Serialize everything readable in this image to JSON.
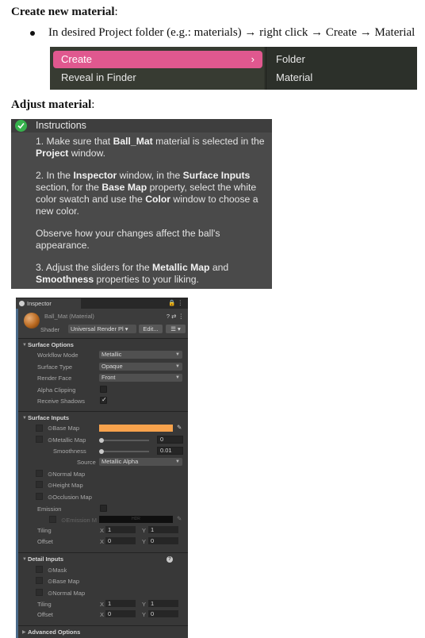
{
  "heading1": {
    "bold": "Create new material",
    "rest": ":"
  },
  "step_text": "In desired Project folder (e.g.: materials) → right click → Create → Material",
  "context_menu": {
    "create": "Create",
    "chevron": "›",
    "reveal": "Reveal in Finder",
    "submenu": [
      "Folder",
      "Material"
    ]
  },
  "heading2": {
    "bold": "Adjust material",
    "rest": ":"
  },
  "instructions": {
    "title": "Instructions",
    "p1": {
      "a": "1. Make sure that ",
      "b": "Ball_Mat",
      "c": " material is selected in the ",
      "d": "Project",
      "e": " window."
    },
    "p2": {
      "a": "2. In the ",
      "b": "Inspector",
      "c": " window, in the ",
      "d": "Surface Inputs",
      "e": " section, for the ",
      "f": "Base Map",
      "g": " property, select the white color swatch and use the ",
      "h": "Color",
      "i": " window to choose a new color."
    },
    "p3": "Observe how your changes affect the ball's appearance.",
    "p4": {
      "a": "3.  Adjust the sliders for the ",
      "b": "Metallic Map",
      "c": " and ",
      "d": "Smoothness",
      "e": " properties to your liking."
    }
  },
  "inspector": {
    "tab": "Inspector",
    "tab_icons": "🔒 ⋮",
    "material_name": "Ball_Mat (Material)",
    "header_icons": "? ⇄ ⋮",
    "shader_label": "Shader",
    "shader_value": "Universal Render Pl ▾",
    "edit_button": "Edit...",
    "list_button": "☰ ▾",
    "surface_options": {
      "title": "Surface Options",
      "workflow_mode": {
        "label": "Workflow Mode",
        "value": "Metallic"
      },
      "surface_type": {
        "label": "Surface Type",
        "value": "Opaque"
      },
      "render_face": {
        "label": "Render Face",
        "value": "Front"
      },
      "alpha_clipping": {
        "label": "Alpha Clipping"
      },
      "receive_shadows": {
        "label": "Receive Shadows",
        "tick": "✓"
      }
    },
    "surface_inputs": {
      "title": "Surface Inputs",
      "base_map": "Base Map",
      "base_color": "#f7a24c",
      "metallic_map": {
        "label": "Metallic Map",
        "value": "0"
      },
      "smoothness": {
        "label": "Smoothness",
        "value": "0.01"
      },
      "source": {
        "label": "Source",
        "value": "Metallic Alpha"
      },
      "normal_map": "Normal Map",
      "height_map": "Height Map",
      "occlusion_map": "Occlusion Map",
      "emission": "Emission",
      "emission_map": "Emission M",
      "hdr": "HDR",
      "tiling": {
        "label": "Tiling",
        "x": "1",
        "y": "1"
      },
      "offset": {
        "label": "Offset",
        "x": "0",
        "y": "0"
      }
    },
    "detail_inputs": {
      "title": "Detail Inputs",
      "mask": "Mask",
      "base_map": "Base Map",
      "normal_map": "Normal Map",
      "tiling": {
        "label": "Tiling",
        "x": "1",
        "y": "1"
      },
      "offset": {
        "label": "Offset",
        "x": "0",
        "y": "0"
      }
    },
    "advanced_options": "Advanced Options",
    "axis_x": "X",
    "axis_y": "Y"
  }
}
